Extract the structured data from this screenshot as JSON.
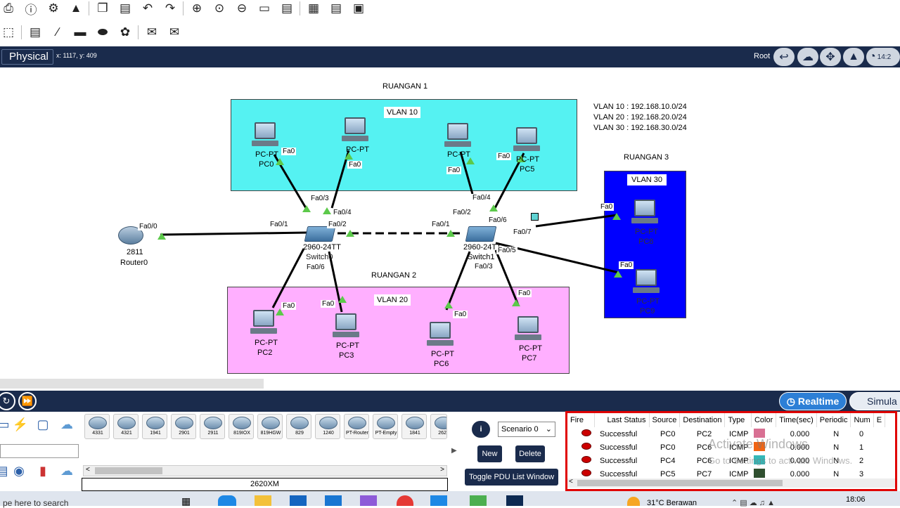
{
  "toolbar": {
    "row1_icons": [
      "print-icon",
      "info-icon",
      "network-wizard-icon",
      "activity-wizard-icon",
      "copy-icon",
      "paste-icon",
      "undo-icon",
      "redo-icon",
      "zoom-in-icon",
      "zoom-reset-icon",
      "zoom-out-icon",
      "drawing-palette-icon",
      "custom-device-icon",
      "notes-icon",
      "device-dialog-icon",
      "image-viewer-icon"
    ],
    "row2_icons": [
      "select-icon",
      "note-icon",
      "line-icon",
      "rectangle-icon",
      "ellipse-icon",
      "freeform-icon",
      "simple-pdu-icon",
      "complex-pdu-icon"
    ]
  },
  "workspace": {
    "mode_label": "Physical",
    "coords": "x: 1117, y: 409",
    "root_label": "Root",
    "clock_partial": "14:2"
  },
  "topology": {
    "rooms": [
      {
        "name": "RUANGAN 1",
        "vlan": "VLAN 10",
        "color": "#55f2f2"
      },
      {
        "name": "RUANGAN 2",
        "vlan": "VLAN 20",
        "color": "#ffafff"
      },
      {
        "name": "RUANGAN 3",
        "vlan": "VLAN 30",
        "color": "#0000ff"
      }
    ],
    "vlan_info": [
      "VLAN 10 : 192.168.10.0/24",
      "VLAN 20 : 192.168.20.0/24",
      "VLAN 30 : 192.168.30.0/24"
    ],
    "router": {
      "model": "2811",
      "name": "Router0",
      "port": "Fa0/0"
    },
    "switch0": {
      "model": "2960-24TT",
      "name": "Switch0"
    },
    "switch1": {
      "model": "2960-24TT",
      "name": "Switch1"
    },
    "pcs": [
      {
        "type": "PC-PT",
        "name": "PC0"
      },
      {
        "type": "PC-PT",
        "name": "PC1"
      },
      {
        "type": "PC-PT",
        "name": "PC4"
      },
      {
        "type": "PC-PT",
        "name": "PC5"
      },
      {
        "type": "PC-PT",
        "name": "PC2"
      },
      {
        "type": "PC-PT",
        "name": "PC3"
      },
      {
        "type": "PC-PT",
        "name": "PC6"
      },
      {
        "type": "PC-PT",
        "name": "PC7"
      },
      {
        "type": "PC-PT",
        "name": "PC8"
      },
      {
        "type": "PC-PT",
        "name": "PC9"
      }
    ],
    "ports": {
      "fa0": "Fa0",
      "fa0_1": "Fa0/1",
      "fa0_2": "Fa0/2",
      "fa0_3": "Fa0/3",
      "fa0_4": "Fa0/4",
      "fa0_5": "Fa0/5",
      "fa0_6": "Fa0/6",
      "fa0_7": "Fa0/7"
    }
  },
  "bottom": {
    "device_tiles": [
      "4331",
      "4321",
      "1941",
      "2901",
      "2911",
      "819IOX",
      "819HGW",
      "829",
      "1240",
      "PT-Router",
      "PT-Empty",
      "1841",
      "2620"
    ],
    "selected_model": "2620XM",
    "scenario": "Scenario 0",
    "new_label": "New",
    "delete_label": "Delete",
    "toggle_label": "Toggle PDU List Window",
    "realtime_label": "Realtime",
    "simulation_label": "Simula"
  },
  "pdu_list": {
    "headers": [
      "Fire",
      "Last Status",
      "Source",
      "Destination",
      "Type",
      "Color",
      "Time(sec)",
      "Periodic",
      "Num",
      "E"
    ],
    "rows": [
      {
        "status": "Successful",
        "source": "PC0",
        "dest": "PC2",
        "type": "ICMP",
        "color": "#d87093",
        "time": "0.000",
        "periodic": "N",
        "num": "0"
      },
      {
        "status": "Successful",
        "source": "PC0",
        "dest": "PC6",
        "type": "ICMP",
        "color": "#f06414",
        "time": "0.000",
        "periodic": "N",
        "num": "1"
      },
      {
        "status": "Successful",
        "source": "PC4",
        "dest": "PC6",
        "type": "ICMP",
        "color": "#35b8b8",
        "time": "0.000",
        "periodic": "N",
        "num": "2"
      },
      {
        "status": "Successful",
        "source": "PC5",
        "dest": "PC7",
        "type": "ICMP",
        "color": "#2f4f2f",
        "time": "0.000",
        "periodic": "N",
        "num": "3"
      }
    ],
    "watermark_line1": "Activate Windows",
    "watermark_line2": "Go to Settings to activate Windows."
  },
  "taskbar": {
    "search_partial": "pe here to search",
    "weather_partial": "31°C  Berawan",
    "time": "18:06"
  }
}
